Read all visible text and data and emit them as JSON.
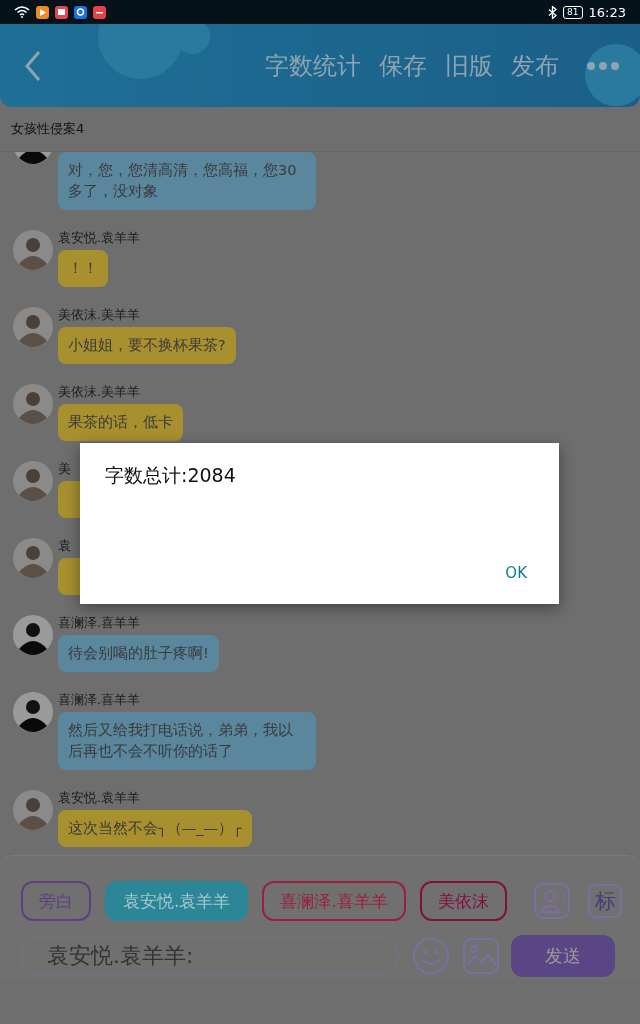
{
  "status_bar": {
    "battery": "81",
    "time": "16:23"
  },
  "header": {
    "actions": [
      "字数统计",
      "保存",
      "旧版",
      "发布"
    ]
  },
  "doc_title": "女孩性侵案4",
  "messages": [
    {
      "text": "对，您，您清高清，您高福，您30多了，没对象",
      "color": "#5a879e"
    },
    {
      "name": "袁安悦.袁羊羊",
      "text": "！！",
      "color": "#a8902f"
    },
    {
      "name": "美依沫.美羊羊",
      "text": "小姐姐，要不换杯果茶?",
      "color": "#a8902f"
    },
    {
      "name": "美依沫.美羊羊",
      "text": "果茶的话，低卡",
      "color": "#a8902f"
    },
    {
      "name": "美",
      "color": "#a8902f"
    },
    {
      "name": "袁",
      "color": "#a8902f"
    },
    {
      "name": "喜澜泽.喜羊羊",
      "text": "待会别喝的肚子疼啊!",
      "color": "#5a879e"
    },
    {
      "name": "喜澜泽.喜羊羊",
      "text": "然后又给我打电话说，弟弟，我以后再也不会不听你的话了",
      "color": "#5a879e"
    },
    {
      "name": "袁安悦.袁羊羊",
      "text": "这次当然不会┐（—_—）┌",
      "color": "#a8902f"
    }
  ],
  "roles": [
    {
      "label": "旁白",
      "selected": false,
      "color": "#5e3f80"
    },
    {
      "label": "袁安悦.袁羊羊",
      "selected": true,
      "color": "#2b8797"
    },
    {
      "label": "喜澜泽.喜羊羊",
      "selected": false,
      "color": "#9c1f3e"
    },
    {
      "label": "美依沫",
      "selected": false,
      "color": "#801040"
    }
  ],
  "mark_key": "标",
  "input": {
    "value": "袁安悦.袁羊羊:"
  },
  "send_button": "发送",
  "dialog": {
    "message": "字数总计:2084",
    "button": "OK"
  }
}
